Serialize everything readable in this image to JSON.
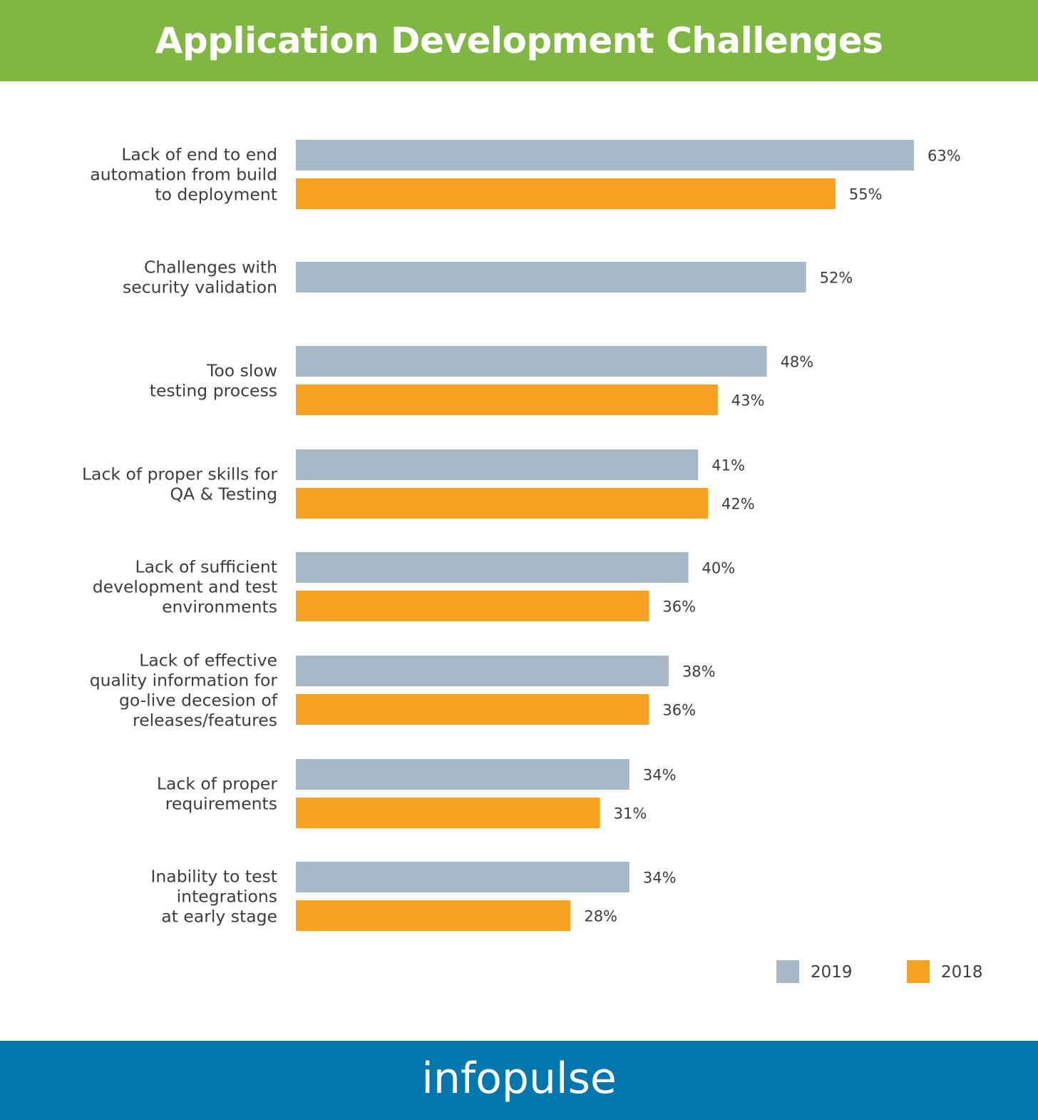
{
  "header": {
    "title": "Application Development Challenges"
  },
  "footer": {
    "brand": "infopulse"
  },
  "colors": {
    "header_bg": "#80b742",
    "footer_bg": "#0177ae",
    "series_2019": "#a7b9c7",
    "series_2018": "#f7a120",
    "text": "#3d3d3d"
  },
  "chart_data": {
    "type": "bar",
    "orientation": "horizontal",
    "title": "Application Development Challenges",
    "xlabel": "",
    "ylabel": "",
    "xlim": [
      0,
      63
    ],
    "grid": false,
    "legend_position": "bottom-right",
    "value_suffix": "%",
    "categories": [
      [
        "Lack of end to end",
        "automation from build",
        "to deployment"
      ],
      [
        "Challenges with",
        "security validation"
      ],
      [
        "Too slow",
        "testing process"
      ],
      [
        "Lack of proper skills for",
        "QA & Testing"
      ],
      [
        "Lack of sufficient",
        "development and test",
        "environments"
      ],
      [
        "Lack of effective",
        "quality information for",
        "go-live decesion of",
        "releases/features"
      ],
      [
        "Lack of proper",
        "requirements"
      ],
      [
        "Inability to test",
        "integrations",
        "at early stage"
      ]
    ],
    "series": [
      {
        "name": "2019",
        "color": "#a7b9c7",
        "values": [
          63,
          52,
          48,
          41,
          40,
          38,
          34,
          34
        ]
      },
      {
        "name": "2018",
        "color": "#f7a120",
        "values": [
          55,
          null,
          43,
          42,
          36,
          36,
          31,
          28
        ]
      }
    ],
    "legend": [
      {
        "label": "2019",
        "color": "#a7b9c7"
      },
      {
        "label": "2018",
        "color": "#f7a120"
      }
    ]
  }
}
